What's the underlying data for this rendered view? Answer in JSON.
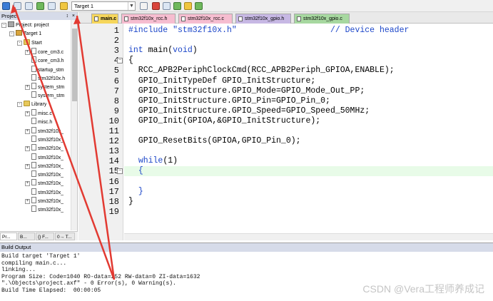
{
  "toolbar": {
    "target": "Target 1",
    "colors": {
      "accent": "#d9443b"
    }
  },
  "project_pane": {
    "title": "Project",
    "pin": "↕",
    "close": "×",
    "tree": [
      {
        "label": "Project: project",
        "depth": 0,
        "type": "proj",
        "exp": "-"
      },
      {
        "label": "Target 1",
        "depth": 1,
        "type": "target",
        "exp": "-"
      },
      {
        "label": "Start",
        "depth": 2,
        "type": "folder",
        "exp": "-"
      },
      {
        "label": "core_cm3.c",
        "depth": 3,
        "type": "file",
        "exp": "+"
      },
      {
        "label": "core_cm3.h",
        "depth": 3,
        "type": "file",
        "exp": ""
      },
      {
        "label": "startup_stm",
        "depth": 3,
        "type": "file",
        "exp": ""
      },
      {
        "label": "stm32f10x.h",
        "depth": 3,
        "type": "file",
        "exp": ""
      },
      {
        "label": "system_stm",
        "depth": 3,
        "type": "file",
        "exp": "+"
      },
      {
        "label": "system_stm",
        "depth": 3,
        "type": "file",
        "exp": ""
      },
      {
        "label": "Library",
        "depth": 2,
        "type": "folder",
        "exp": "-"
      },
      {
        "label": "misc.c",
        "depth": 3,
        "type": "file",
        "exp": "+"
      },
      {
        "label": "misc.h",
        "depth": 3,
        "type": "file",
        "exp": ""
      },
      {
        "label": "stm32f10x_",
        "depth": 3,
        "type": "file",
        "exp": "+"
      },
      {
        "label": "stm32f10x_",
        "depth": 3,
        "type": "file",
        "exp": ""
      },
      {
        "label": "stm32f10x_",
        "depth": 3,
        "type": "file",
        "exp": "+"
      },
      {
        "label": "stm32f10x_",
        "depth": 3,
        "type": "file",
        "exp": ""
      },
      {
        "label": "stm32f10x_",
        "depth": 3,
        "type": "file",
        "exp": "+"
      },
      {
        "label": "stm32f10x_",
        "depth": 3,
        "type": "file",
        "exp": ""
      },
      {
        "label": "stm32f10x_",
        "depth": 3,
        "type": "file",
        "exp": "+"
      },
      {
        "label": "stm32f10x_",
        "depth": 3,
        "type": "file",
        "exp": ""
      },
      {
        "label": "stm32f10x_",
        "depth": 3,
        "type": "file",
        "exp": "+"
      },
      {
        "label": "stm32f10x_",
        "depth": 3,
        "type": "file",
        "exp": ""
      }
    ],
    "tabs": [
      "Pr...",
      "B...",
      "{} F...",
      "0→ T..."
    ]
  },
  "editor": {
    "tabs": [
      {
        "label": "main.c",
        "style": "active"
      },
      {
        "label": "stm32f10x_rcc.h",
        "style": "pink"
      },
      {
        "label": "stm32f10x_rcc.c",
        "style": "pink"
      },
      {
        "label": "stm32f10x_gpio.h",
        "style": "purple"
      },
      {
        "label": "stm32f10x_gpio.c",
        "style": "green"
      }
    ],
    "line_numbers": [
      "1",
      "2",
      "3",
      "4",
      "5",
      "6",
      "7",
      "8",
      "9",
      "10",
      "11",
      "12",
      "13",
      "14",
      "15",
      "16",
      "17",
      "18",
      "19"
    ],
    "highlighted_line": 15,
    "lines": [
      [
        {
          "t": "#include \"stm32f10x.h\"",
          "c": "str"
        },
        {
          "t": "                   // Device header",
          "c": "cm"
        }
      ],
      [],
      [
        {
          "t": "int",
          "c": "kw"
        },
        {
          "t": " main(",
          "c": ""
        },
        {
          "t": "void",
          "c": "kw"
        },
        {
          "t": ")",
          "c": ""
        }
      ],
      [
        {
          "t": "{",
          "c": ""
        }
      ],
      [
        {
          "t": "  RCC_APB2PeriphClockCmd(RCC_APB2Periph_GPIOA,ENABLE);",
          "c": ""
        }
      ],
      [
        {
          "t": "  GPIO_InitTypeDef GPIO_InitStructure;",
          "c": ""
        }
      ],
      [
        {
          "t": "  GPIO_InitStructure.GPIO_Mode=GPIO_Mode_Out_PP;",
          "c": ""
        }
      ],
      [
        {
          "t": "  GPIO_InitStructure.GPIO_Pin=GPIO_Pin_0;",
          "c": ""
        }
      ],
      [
        {
          "t": "  GPIO_InitStructure.GPIO_Speed=GPIO_Speed_50MHz;",
          "c": ""
        }
      ],
      [
        {
          "t": "  GPIO_Init(GPIOA,&GPIO_InitStructure);",
          "c": ""
        }
      ],
      [],
      [
        {
          "t": "  GPIO_ResetBits(GPIOA,GPIO_Pin_0);",
          "c": ""
        }
      ],
      [],
      [
        {
          "t": "  ",
          "c": ""
        },
        {
          "t": "while",
          "c": "kw"
        },
        {
          "t": "(1)",
          "c": ""
        }
      ],
      [
        {
          "t": "  ",
          "c": ""
        },
        {
          "t": "{",
          "c": "brace"
        }
      ],
      [],
      [
        {
          "t": "  ",
          "c": ""
        },
        {
          "t": "}",
          "c": "brace"
        }
      ],
      [
        {
          "t": "}",
          "c": ""
        }
      ],
      []
    ]
  },
  "build_output": {
    "title": "Build Output",
    "lines": [
      "Build target 'Target 1'",
      "compiling main.c...",
      "linking...",
      "Program Size: Code=1040 RO-data=252 RW-data=0 ZI-data=1632",
      "\".\\Objects\\project.axf\" - 0 Error(s), 0 Warning(s).",
      "Build Time Elapsed:  00:00:05"
    ]
  },
  "watermark": "CSDN @Vera工程师养成记"
}
